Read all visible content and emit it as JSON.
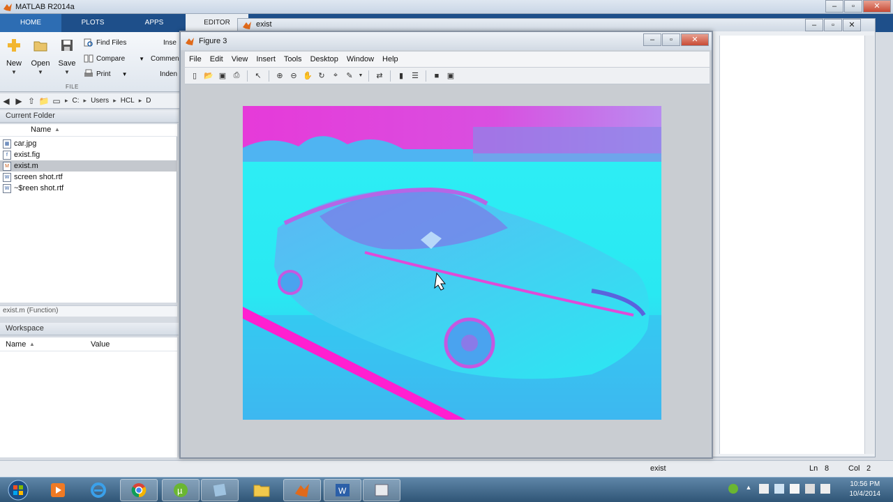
{
  "app": {
    "title": "MATLAB R2014a"
  },
  "toolstrip": {
    "tabs": [
      "HOME",
      "PLOTS",
      "APPS",
      "EDITOR"
    ]
  },
  "ribbon": {
    "new_label": "New",
    "open_label": "Open",
    "save_label": "Save",
    "find_files": "Find Files",
    "compare": "Compare",
    "print": "Print",
    "insert_partial": "Inse",
    "comment_partial": "Commen",
    "indent_partial": "Inden",
    "section_file": "FILE"
  },
  "address": {
    "crumbs": [
      "C:",
      "Users",
      "HCL",
      "D"
    ]
  },
  "current_folder": {
    "title": "Current Folder",
    "name_col": "Name",
    "files": [
      {
        "name": "car.jpg",
        "icon": "image-file-icon"
      },
      {
        "name": "exist.fig",
        "icon": "fig-file-icon"
      },
      {
        "name": "exist.m",
        "icon": "m-file-icon",
        "selected": true
      },
      {
        "name": "screen shot.rtf",
        "icon": "word-file-icon"
      },
      {
        "name": "~$reen shot.rtf",
        "icon": "word-file-icon"
      }
    ],
    "details": "exist.m",
    "details_type": "(Function)"
  },
  "workspace": {
    "title": "Workspace",
    "name_col": "Name",
    "value_col": "Value"
  },
  "editor": {
    "title": "exist",
    "status_file": "exist",
    "ln_label": "Ln",
    "ln_value": "8",
    "col_label": "Col",
    "col_value": "2"
  },
  "figure": {
    "title": "Figure 3",
    "menu": [
      "File",
      "Edit",
      "View",
      "Insert",
      "Tools",
      "Desktop",
      "Window",
      "Help"
    ]
  },
  "taskbar": {
    "time": "10:56 PM",
    "date": "10/4/2014"
  }
}
